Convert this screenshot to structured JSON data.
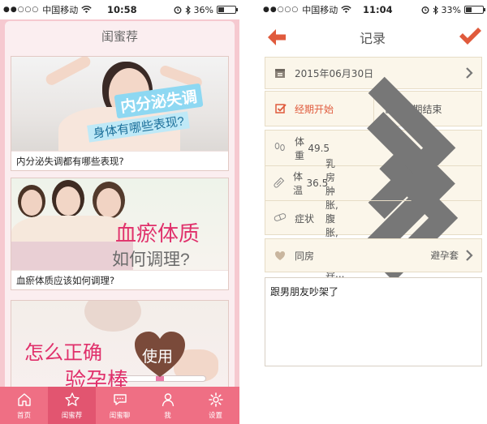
{
  "left": {
    "status": {
      "carrier": "中国移动",
      "time": "10:58",
      "battery": "36%",
      "battery_level": 0.36
    },
    "header": {
      "title": "闺蜜荐"
    },
    "cards": [
      {
        "caption": "内分泌失调都有哪些表现?",
        "overlay_line1": "内分泌失调",
        "overlay_line2": "身体有哪些表现?"
      },
      {
        "caption": "血瘀体质应该如何调理?",
        "overlay_line1": "血瘀体质",
        "overlay_line2": "如何调理?"
      },
      {
        "overlay_line1": "怎么正确",
        "overlay_line2": "验孕棒",
        "badge": "使用"
      }
    ],
    "tabs": [
      {
        "label": "首页",
        "icon": "home-icon"
      },
      {
        "label": "闺蜜荐",
        "icon": "star-icon"
      },
      {
        "label": "闺蜜聊",
        "icon": "chat-icon"
      },
      {
        "label": "我",
        "icon": "user-icon"
      },
      {
        "label": "设置",
        "icon": "gear-icon"
      }
    ],
    "active_tab": 1
  },
  "right": {
    "status": {
      "carrier": "中国移动",
      "time": "11:04",
      "battery": "33%",
      "battery_level": 0.33
    },
    "header": {
      "title": "记录"
    },
    "date": "2015年06月30日",
    "period": {
      "start_label": "经期开始",
      "end_label": "经期结束"
    },
    "metrics": [
      {
        "label": "体重",
        "value": "49.5",
        "icon": "footprints-icon"
      },
      {
        "label": "体温",
        "value": "36.5",
        "icon": "thermometer-icon"
      },
      {
        "label": "症状",
        "value": "乳房肿胀,腹胀,白带异...",
        "icon": "pill-icon"
      }
    ],
    "intimacy": {
      "label": "同房",
      "value": "避孕套",
      "icon": "heart-icon"
    },
    "note": "跟男朋友吵架了"
  },
  "colors": {
    "pink": "#ef6f84",
    "pink_dark": "#e25570",
    "red_accent": "#e05a3c",
    "cream": "#fbf6ea"
  }
}
